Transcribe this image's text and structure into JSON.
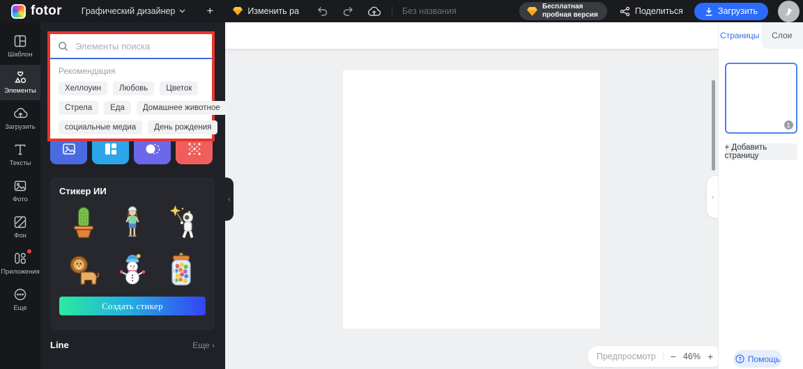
{
  "colors": {
    "accent_blue": "#2b6bfd",
    "annotation_red": "#e8352e",
    "tile_blue": "#4a6be0",
    "tile_cyan": "#2ba7e9",
    "tile_purple": "#6b68ea",
    "tile_red": "#f05e5c"
  },
  "topbar": {
    "logo_text": "fotor",
    "doc_type": "Графический дизайнер",
    "plus": "+",
    "resize_label": "Изменить ра",
    "untitled": "Без названия",
    "trial_line1": "Бесплатная",
    "trial_line2": "пробная версия",
    "share": "Поделиться",
    "download": "Загрузить"
  },
  "sidebar": {
    "items": [
      {
        "label": "Шаблон"
      },
      {
        "label": "Элементы",
        "active": true
      },
      {
        "label": "Загрузить"
      },
      {
        "label": "Тексты"
      },
      {
        "label": "Фото"
      },
      {
        "label": "Фон"
      },
      {
        "label": "Приложения",
        "badge": true
      },
      {
        "label": "Еще"
      }
    ]
  },
  "elements_panel": {
    "search_placeholder": "Элементы поиска",
    "recommend_label": "Рекомендация",
    "tags": [
      "Хеллоуин",
      "Любовь",
      "Цветок",
      "Стрела",
      "Еда",
      "Домашнее животное",
      "социальные медиа",
      "День рождения"
    ],
    "tiles": [
      "photo-tile",
      "collage-tile",
      "mask-tile",
      "pattern-tile"
    ],
    "sticker": {
      "title": "Стикер ИИ",
      "button": "Создать стикер",
      "stickers": [
        "cactus",
        "girl",
        "astronaut",
        "lion",
        "snowman",
        "candy-jar"
      ]
    },
    "line_section": {
      "title": "Line",
      "more": "Еще"
    }
  },
  "right_panel": {
    "tabs": [
      {
        "label": "Страницы",
        "active": true
      },
      {
        "label": "Слои"
      }
    ],
    "page_badge": "1",
    "add_page": "+ Добавить страницу",
    "help": "Помощь"
  },
  "canvas_footer": {
    "preview": "Предпросмотр",
    "minus": "−",
    "zoom": "46%",
    "plus": "+"
  },
  "icons": {
    "chevron_left": "‹",
    "chevron_right": "›"
  }
}
